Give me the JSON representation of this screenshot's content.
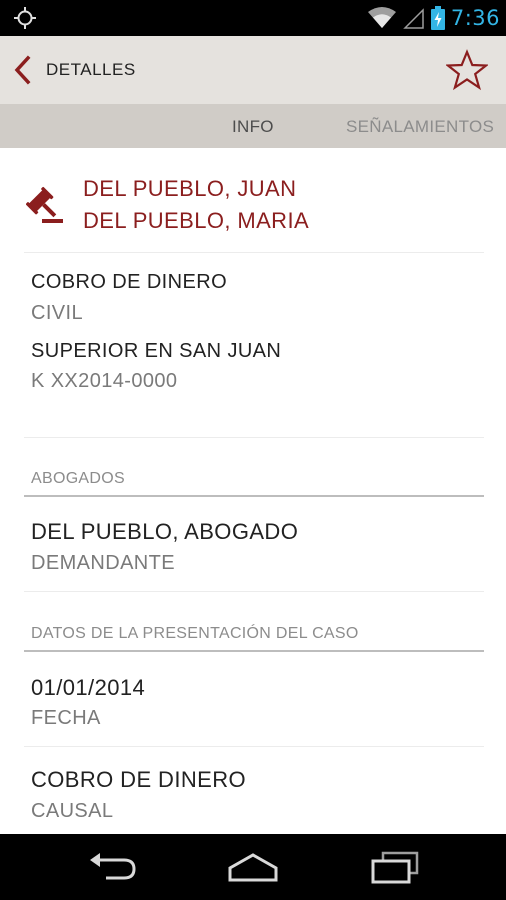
{
  "status_bar": {
    "time": "7:36",
    "icons": [
      "gps-icon",
      "wifi-icon",
      "signal-icon",
      "battery-charging-icon"
    ]
  },
  "action_bar": {
    "title": "DETALLES",
    "icons": [
      "back-chevron-icon",
      "star-icon"
    ]
  },
  "tabs": [
    {
      "label": "INFO"
    },
    {
      "label": "SEÑALAMIENTOS"
    }
  ],
  "case": {
    "party_icon": "gavel-icon",
    "parties": [
      "DEL PUEBLO, JUAN",
      "DEL PUEBLO, MARIA"
    ],
    "matter": "COBRO DE DINERO",
    "matter_type": "CIVIL",
    "court": "SUPERIOR EN SAN JUAN",
    "case_number": "K XX2014-0000"
  },
  "lawyers": {
    "header": "ABOGADOS",
    "items": [
      {
        "name": "DEL PUEBLO, ABOGADO",
        "role": "DEMANDANTE"
      }
    ]
  },
  "filing": {
    "header": "DATOS DE LA PRESENTACIÓN DEL CASO",
    "items": [
      {
        "value": "01/01/2014",
        "label": "FECHA"
      },
      {
        "value": "COBRO DE DINERO",
        "label": "CAUSAL"
      }
    ]
  },
  "nav_bar": {
    "icons": [
      "back-nav-icon",
      "home-nav-icon",
      "recent-apps-icon"
    ]
  }
}
